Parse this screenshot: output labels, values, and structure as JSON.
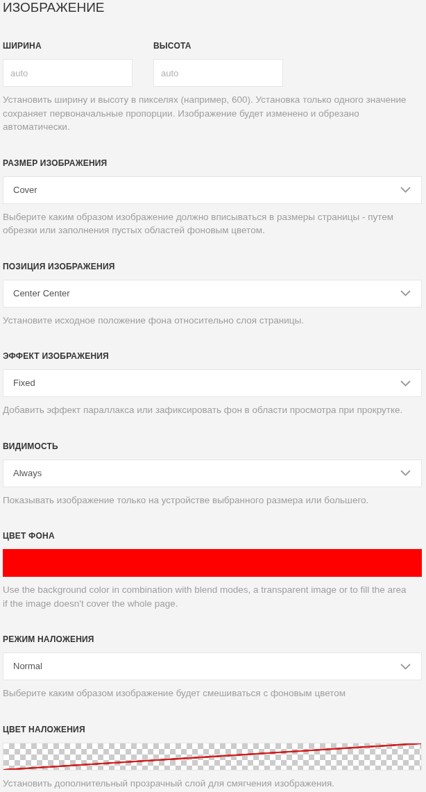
{
  "section": {
    "title": "ИЗОБРАЖЕНИЕ"
  },
  "fields": [
    {
      "kind": "pair",
      "inputs": [
        {
          "label": "ШИРИНА",
          "placeholder": "auto"
        },
        {
          "label": "ВЫСОТА",
          "placeholder": "auto"
        }
      ],
      "help": "Установить ширину и высоту в пикселях (например, 600). Установка только одного значение сохраняет первоначальные пропорции. Изображение будет изменено и обрезано автоматически."
    },
    {
      "kind": "select",
      "label": "РАЗМЕР ИЗОБРАЖЕНИЯ",
      "value": "Cover",
      "help": "Выберите каким образом изображение должно вписываться в размеры страницы - путем обрезки или заполнения пустых областей фоновым цветом."
    },
    {
      "kind": "select",
      "label": "ПОЗИЦИЯ ИЗОБРАЖЕНИЯ",
      "value": "Center Center",
      "help": "Установите исходное положение фона относительно слоя страницы."
    },
    {
      "kind": "select",
      "label": "ЭФФЕКТ ИЗОБРАЖЕНИЯ",
      "value": "Fixed",
      "help": "Добавить эффект параллакса или зафиксировать фон в области просмотра при прокрутке."
    },
    {
      "kind": "select",
      "label": "ВИДИМОСТЬ",
      "value": "Always",
      "help": "Показывать изображение только на устройстве выбранного размера или большего."
    },
    {
      "kind": "color",
      "label": "ЦВЕТ ФОНА",
      "color": "#ff0000",
      "help": "Use the background color in combination with blend modes, a transparent image or to fill the area if the image doesn't cover the whole page."
    },
    {
      "kind": "select",
      "label": "РЕЖИМ НАЛОЖЕНИЯ",
      "value": "Normal",
      "help": "Выберите каким образом изображение будет смешиваться с фоновым цветом"
    },
    {
      "kind": "color",
      "label": "ЦВЕТ НАЛОЖЕНИЯ",
      "help": "Установить дополнительный прозрачный слой для смягчения изображения."
    }
  ]
}
